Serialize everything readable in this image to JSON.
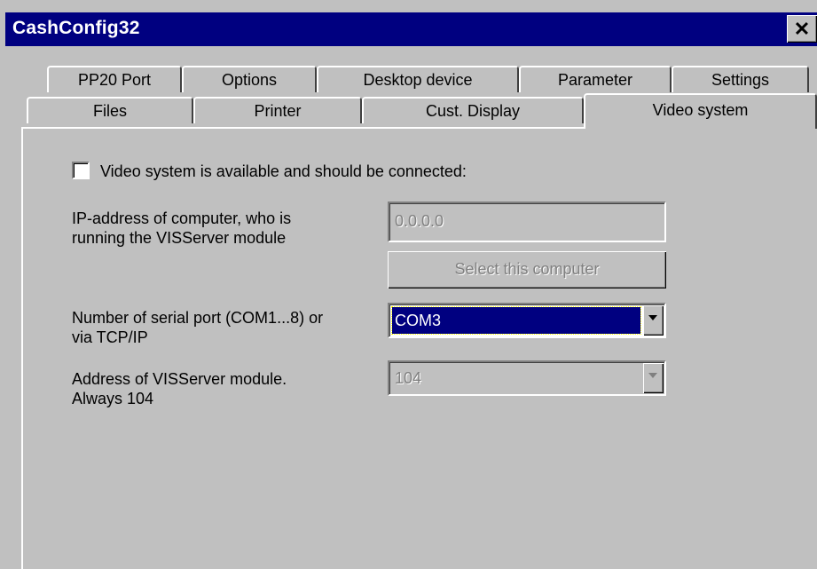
{
  "window": {
    "title": "CashConfig32",
    "close_glyph": "✕"
  },
  "tabs": {
    "row1": [
      "PP20 Port",
      "Options",
      "Desktop device",
      "Parameter",
      "Settings"
    ],
    "row2": [
      "Files",
      "Printer",
      "Cust. Display",
      "Video system"
    ],
    "active": "Video system"
  },
  "video": {
    "checkbox_label": "Video system is available and should be connected:",
    "checked": false,
    "ip_label_line1": "IP-address of computer, who is",
    "ip_label_line2": "running the VISServer module",
    "ip_value": "0.0.0.0",
    "select_button": "Select this computer",
    "serial_label_line1": "Number of serial port (COM1...8) or",
    "serial_label_line2": "via TCP/IP",
    "serial_value": "COM3",
    "address_label_line1": "Address of VISServer module.",
    "address_label_line2": "Always 104",
    "address_value": "104"
  },
  "colors": {
    "titlebar": "#000080",
    "face": "#c0c0c0",
    "selection": "#000080",
    "disabled_text": "#808080"
  }
}
